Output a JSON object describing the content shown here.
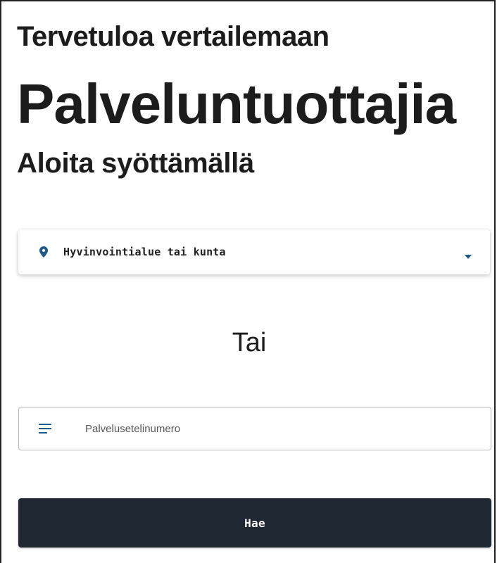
{
  "header": {
    "welcome": "Tervetuloa vertailemaan",
    "headline": "Palveluntuottajia",
    "subhead": "Aloita syöttämällä"
  },
  "region_select": {
    "label": "Hyvinvointialue tai kunta",
    "icon": "location-pin-icon",
    "caret_icon": "dropdown-caret-icon"
  },
  "separator": {
    "text": "Tai"
  },
  "voucher_field": {
    "placeholder": "Palvelusetelinumero",
    "icon": "notes-lines-icon"
  },
  "search_button": {
    "label": "Hae"
  },
  "colors": {
    "accent_blue": "#1e5a8c",
    "button_bg": "#1f2733",
    "text": "#1c1c1c"
  }
}
